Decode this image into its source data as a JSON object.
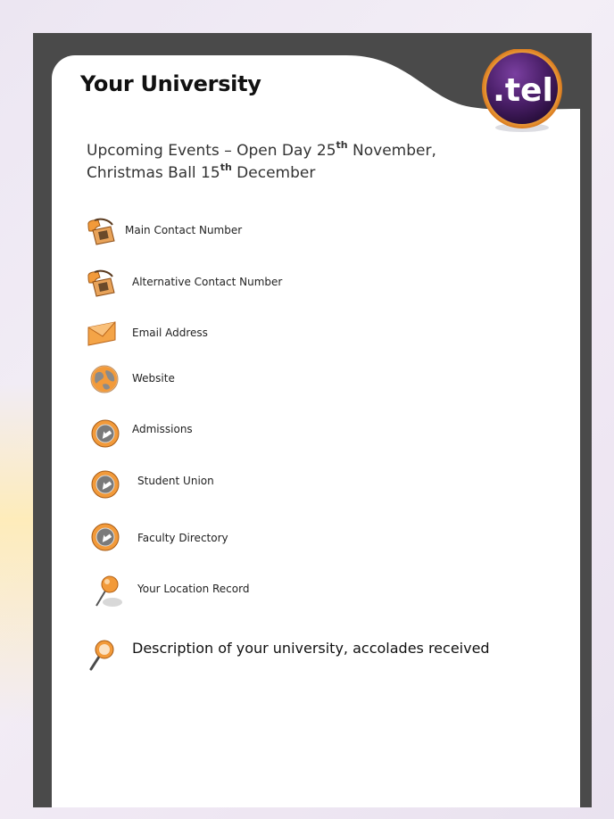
{
  "page": {
    "title": "Your University",
    "badge_text": ".tel"
  },
  "events": {
    "line1_prefix": "Upcoming Events – Open Day 25",
    "line1_sup": "th",
    "line1_suffix": " November,",
    "line2_prefix": "Christmas Ball 15",
    "line2_sup": "th",
    "line2_suffix": " December"
  },
  "contacts": [
    {
      "label": "Main Contact Number",
      "icon": "phone-icon"
    },
    {
      "label": "Alternative Contact Number",
      "icon": "phone-icon"
    },
    {
      "label": "Email Address",
      "icon": "envelope-icon"
    },
    {
      "label": "Website",
      "icon": "globe-icon"
    },
    {
      "label": "Admissions",
      "icon": "arrow-circle-icon"
    },
    {
      "label": "Student Union",
      "icon": "arrow-circle-icon"
    },
    {
      "label": "Faculty Directory",
      "icon": "arrow-circle-icon"
    },
    {
      "label": "Your Location Record",
      "icon": "map-pin-icon"
    },
    {
      "label": "Description of your university, accolades received",
      "icon": "magnifier-icon"
    }
  ],
  "colors": {
    "frame": "#4a4a4a",
    "orange": "#f29a3a",
    "badge_purple": "#4a1f68"
  }
}
